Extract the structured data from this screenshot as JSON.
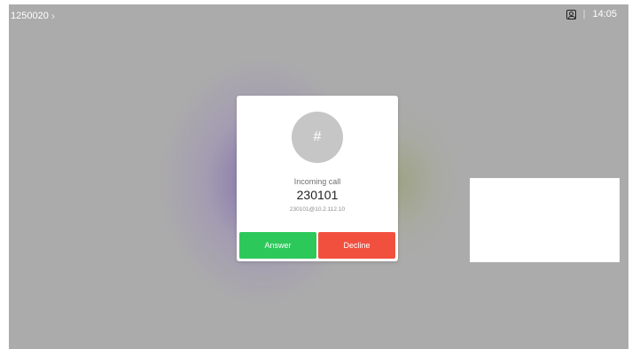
{
  "status_bar": {
    "device_number": "1250020",
    "chevron": "›",
    "presenter_icon": "presenter-icon",
    "separator": "|",
    "time": "14:05"
  },
  "incoming_call": {
    "avatar_glyph": "#",
    "label": "Incoming call",
    "number": "230101",
    "address": "230101@10.2.112.10",
    "answer_label": "Answer",
    "decline_label": "Decline",
    "colors": {
      "answer": "#2dc85a",
      "decline": "#f2503f",
      "avatar": "#c6c6c6",
      "background": "#ababab"
    }
  }
}
